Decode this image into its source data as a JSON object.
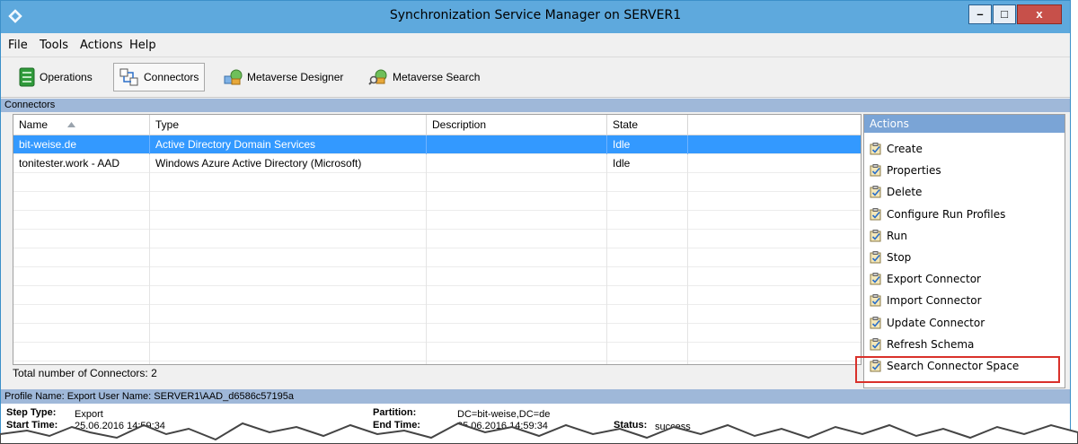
{
  "window": {
    "title": "Synchronization Service Manager on SERVER1",
    "controls": {
      "minimize": "–",
      "maximize": "□",
      "close": "x"
    }
  },
  "menu": [
    "File",
    "Tools",
    "Actions",
    "Help"
  ],
  "toolbar": {
    "buttons": [
      {
        "label": "Operations",
        "icon": "operations-icon"
      },
      {
        "label": "Connectors",
        "icon": "connectors-icon",
        "active": true
      },
      {
        "label": "Metaverse Designer",
        "icon": "metaverse-designer-icon"
      },
      {
        "label": "Metaverse Search",
        "icon": "metaverse-search-icon"
      }
    ]
  },
  "connectors": {
    "section_label": "Connectors",
    "columns": [
      "Name",
      "Type",
      "Description",
      "State"
    ],
    "rows": [
      {
        "name": "bit-weise.de",
        "type": "Active Directory Domain Services",
        "description": "",
        "state": "Idle",
        "selected": true
      },
      {
        "name": "tonitester.work - AAD",
        "type": "Windows Azure Active Directory (Microsoft)",
        "description": "",
        "state": "Idle",
        "selected": false
      }
    ],
    "total_label": "Total number of Connectors: 2"
  },
  "actions": {
    "header": "Actions",
    "items": [
      "Create",
      "Properties",
      "Delete",
      "Configure Run Profiles",
      "Run",
      "Stop",
      "Export Connector",
      "Import Connector",
      "Update Connector",
      "Refresh Schema",
      "Search Connector Space"
    ],
    "highlighted": "Search Connector Space"
  },
  "profile": {
    "header": "Profile Name: Export  User Name: SERVER1\\AAD_d6586c57195a",
    "step_type_label": "Step Type:",
    "step_type_value": "Export",
    "start_time_label": "Start Time:",
    "start_time_value": "25.06.2016 14:59:34",
    "partition_label": "Partition:",
    "partition_value": "DC=bit-weise,DC=de",
    "end_time_label": "End Time:",
    "end_time_value": "25.06.2016 14:59:34",
    "status_label": "Status:",
    "status_value": "success"
  },
  "colors": {
    "titlebar": "#5ea9dd",
    "selection": "#3399ff",
    "actions_header": "#7aa4d6",
    "highlight_border": "#d9312b"
  }
}
